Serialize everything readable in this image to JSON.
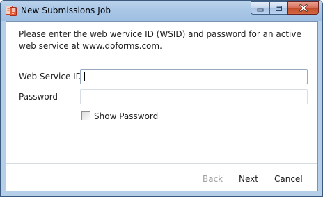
{
  "window": {
    "title": "New Submissions Job",
    "app_icon": "doforms-app-icon"
  },
  "caption_buttons": {
    "minimize_icon": "minimize-icon",
    "maximize_icon": "maximize-icon",
    "close_icon": "close-icon"
  },
  "instructions": "Please enter the web wervice ID (WSID) and password for an active web service at www.doforms.com.",
  "fields": {
    "wsid_label": "Web Service ID",
    "wsid_value": "",
    "password_label": "Password",
    "password_value": ""
  },
  "show_password": {
    "label": "Show Password",
    "checked": false
  },
  "buttons": {
    "back": "Back",
    "next": "Next",
    "cancel": "Cancel"
  },
  "colors": {
    "titlebar": "#a9c6e6",
    "close_button": "#c14a2c",
    "disabled_text": "#a0a0a0"
  }
}
